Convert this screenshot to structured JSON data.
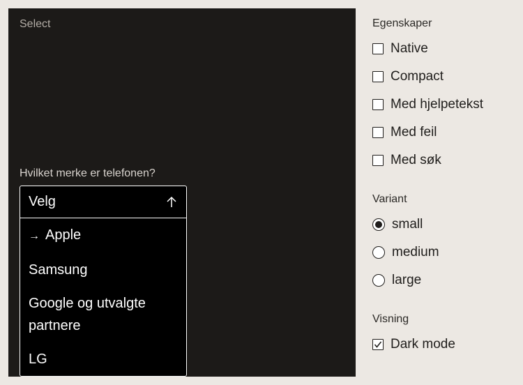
{
  "preview": {
    "title": "Select",
    "field_label": "Hvilket merke er telefonen?",
    "selected_value": "Velg",
    "options": [
      {
        "label": "Apple",
        "active": true
      },
      {
        "label": "Samsung",
        "active": false
      },
      {
        "label": "Google og utvalgte partnere",
        "active": false
      },
      {
        "label": "LG",
        "active": false
      }
    ],
    "active_marker": "→"
  },
  "properties": {
    "title": "Egenskaper",
    "items": [
      {
        "label": "Native",
        "checked": false
      },
      {
        "label": "Compact",
        "checked": false
      },
      {
        "label": "Med hjelpetekst",
        "checked": false
      },
      {
        "label": "Med feil",
        "checked": false
      },
      {
        "label": "Med søk",
        "checked": false
      }
    ]
  },
  "variant": {
    "title": "Variant",
    "options": [
      {
        "label": "small",
        "selected": true
      },
      {
        "label": "medium",
        "selected": false
      },
      {
        "label": "large",
        "selected": false
      }
    ]
  },
  "display": {
    "title": "Visning",
    "items": [
      {
        "label": "Dark mode",
        "checked": true
      }
    ]
  },
  "icons": {
    "trigger": "arrow-up-icon",
    "checked": "checkmark-icon"
  },
  "colors": {
    "page_background": "#ece8e3",
    "preview_background": "#1c1a18",
    "select_background": "#000000",
    "text_dark": "#1f1d1b"
  }
}
